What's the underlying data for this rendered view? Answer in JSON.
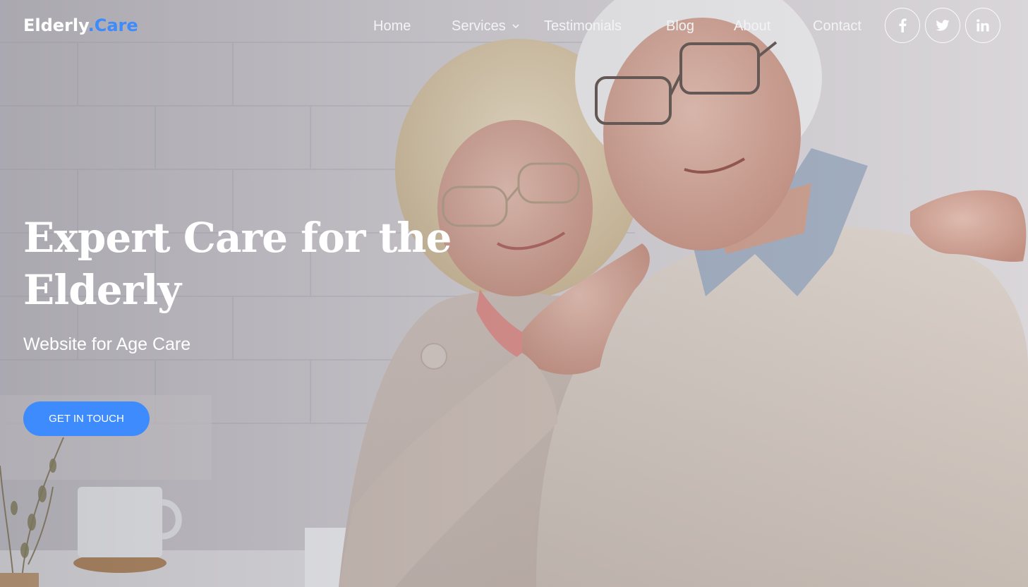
{
  "brand": {
    "name": "Elderly",
    "accent_part": ".Care",
    "accent_color": "#3d8bfd"
  },
  "nav": {
    "items": [
      {
        "label": "Home"
      },
      {
        "label": "Services",
        "has_dropdown": true
      },
      {
        "label": "Testimonials"
      },
      {
        "label": "Blog"
      },
      {
        "label": "About"
      },
      {
        "label": "Contact"
      }
    ],
    "dropdown_icon": "chevron-down-icon"
  },
  "social": [
    {
      "icon": "facebook-icon"
    },
    {
      "icon": "twitter-icon"
    },
    {
      "icon": "linkedin-icon"
    }
  ],
  "hero": {
    "title_line1": "Expert Care for the",
    "title_line2": "Elderly",
    "subtitle": "Website for Age Care",
    "cta_label": "GET IN TOUCH",
    "cta_color": "#3d8bfd"
  }
}
